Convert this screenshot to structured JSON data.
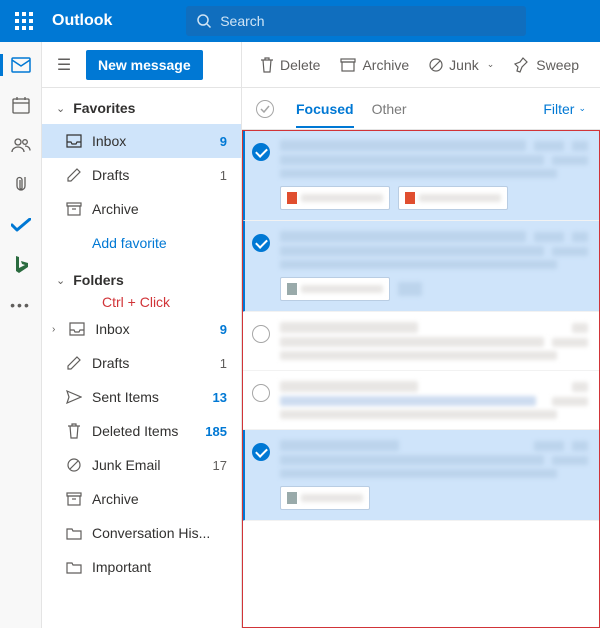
{
  "brand": "Outlook",
  "search": {
    "placeholder": "Search"
  },
  "newMessage": "New message",
  "commands": {
    "delete": "Delete",
    "archive": "Archive",
    "junk": "Junk",
    "sweep": "Sweep"
  },
  "favorites": {
    "header": "Favorites",
    "items": [
      {
        "label": "Inbox",
        "count": "9",
        "active": true
      },
      {
        "label": "Drafts",
        "count": "1"
      },
      {
        "label": "Archive"
      }
    ],
    "addLink": "Add favorite"
  },
  "folders": {
    "header": "Folders",
    "items": [
      {
        "label": "Inbox",
        "count": "9",
        "blue": true,
        "expandable": true
      },
      {
        "label": "Drafts",
        "count": "1"
      },
      {
        "label": "Sent Items",
        "count": "13",
        "blue": true
      },
      {
        "label": "Deleted Items",
        "count": "185",
        "blue": true
      },
      {
        "label": "Junk Email",
        "count": "17"
      },
      {
        "label": "Archive"
      },
      {
        "label": "Conversation His..."
      },
      {
        "label": "Important"
      }
    ]
  },
  "annotation": "Ctrl + Click",
  "tabs": {
    "focused": "Focused",
    "other": "Other"
  },
  "filter": "Filter"
}
